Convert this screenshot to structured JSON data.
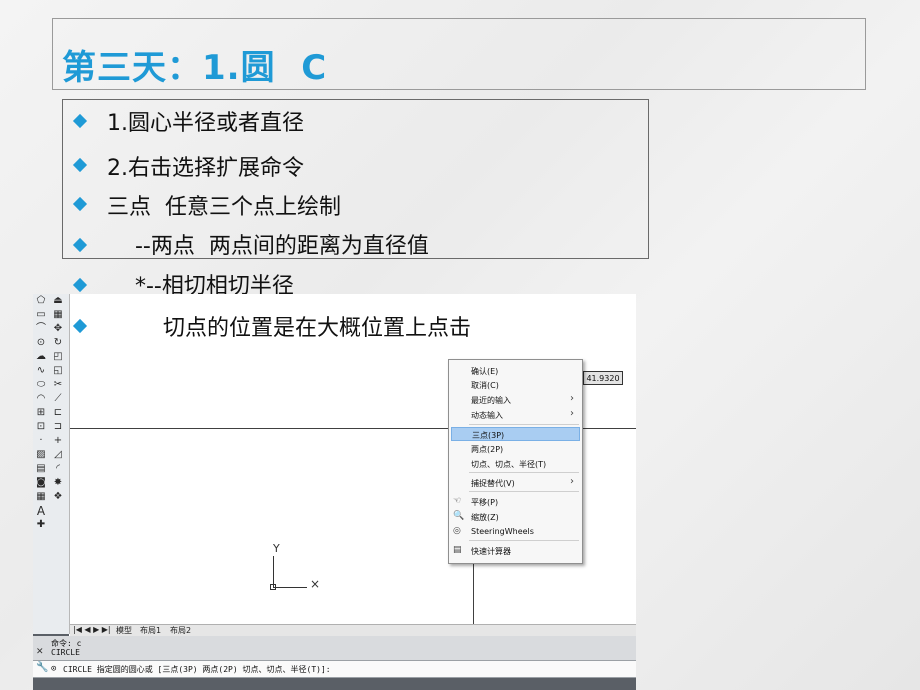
{
  "slide": {
    "title": "第三天：1.圆  C",
    "accent_color": "#1f9ad6",
    "bullets": [
      "1.圆心半径或者直径",
      "2.右击选择扩展命令",
      "三点  任意三个点上绘制",
      "    --两点  两点间的距离为直径值",
      "    *--相切相切半径",
      "        切点的位置是在大概位置上点击"
    ]
  },
  "cad": {
    "tooltip_value": "41.9320",
    "ucs": {
      "y_label": "Y",
      "x_label": "×"
    },
    "layout_tabs": {
      "nav": "|◀ ◀ ▶ ▶|",
      "model": "模型",
      "layout1": "布局1",
      "layout2": "布局2"
    },
    "command": {
      "history_line1": "命令: c",
      "history_line2": "CIRCLE",
      "prompt": "CIRCLE 指定圆的圆心或 [三点(3P) 两点(2P) 切点、切点、半径(T)]:",
      "close_icon": "close-icon",
      "wrench_icon": "wrench-icon"
    },
    "context_menu": {
      "items": [
        {
          "label": "确认(E)",
          "submenu": false
        },
        {
          "label": "取消(C)",
          "submenu": false
        },
        {
          "label": "最近的输入",
          "submenu": true
        },
        {
          "label": "动态输入",
          "submenu": true
        },
        {
          "label": "三点(3P)",
          "submenu": false,
          "highlighted": true
        },
        {
          "label": "两点(2P)",
          "submenu": false
        },
        {
          "label": "切点、切点、半径(T)",
          "submenu": false
        },
        {
          "label": "捕捉替代(V)",
          "submenu": true
        },
        {
          "label": "平移(P)",
          "icon": "pan-icon"
        },
        {
          "label": "缩放(Z)",
          "icon": "zoom-icon"
        },
        {
          "label": "SteeringWheels",
          "icon": "steeringwheels-icon"
        },
        {
          "label": "快速计算器",
          "icon": "calculator-icon"
        }
      ],
      "submenu_arrow": "›",
      "highlight_color": "#a9cdf2"
    }
  }
}
